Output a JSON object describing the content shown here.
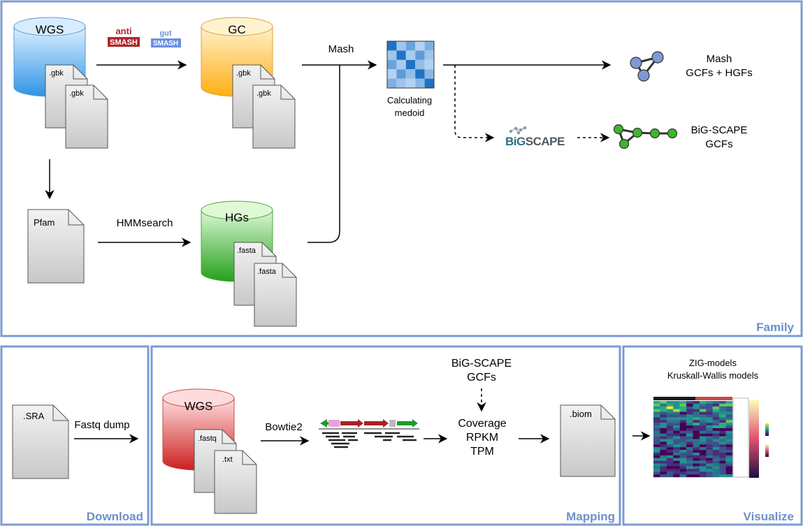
{
  "panels": {
    "family": "Family",
    "download": "Download",
    "mapping": "Mapping",
    "visualize": "Visualize"
  },
  "databases": {
    "wgs_top": "WGS",
    "gc": "GC",
    "hgs": "HGs",
    "wgs_mapping": "WGS"
  },
  "files": {
    "gbk": ".gbk",
    "fasta": ".fasta",
    "pfam": "Pfam",
    "sra": ".SRA",
    "fastq": ".fastq",
    "txt": ".txt",
    "biom": ".biom"
  },
  "logos": {
    "antismash_top": "anti",
    "antismash_bottom": "SMASH",
    "gutsmash_top": "gut",
    "gutsmash_bottom": "SMASH",
    "bigscape": "BiGSCAPE",
    "bigscape_big": "BiG",
    "bigscape_scape": "SCAPE"
  },
  "labels": {
    "mash": "Mash",
    "hmmsearch": "HMMsearch",
    "medoid_line1": "Calculating",
    "medoid_line2": "medoid",
    "mash_out_line1": "Mash",
    "mash_out_line2": "GCFs + HGFs",
    "bigscape_out_line1": "BiG-SCAPE",
    "bigscape_out_line2": "GCFs",
    "fastq_dump": "Fastq dump",
    "bowtie2": "Bowtie2",
    "bigscape_mapping_line1": "BiG-SCAPE",
    "bigscape_mapping_line2": "GCFs",
    "coverage": "Coverage",
    "rpkm": "RPKM",
    "tpm": "TPM",
    "zig": "ZIG-models",
    "kruskal": "Kruskall-Wallis models"
  },
  "colors": {
    "panel_border": "#7c9bd1",
    "panel_title": "#6e8fc9",
    "wgs_blue": "#3d9de8",
    "gc_orange": "#ffb822",
    "hgs_green": "#3aae2c",
    "wgs_red": "#d42f2f",
    "node_blue": "#7f98d6",
    "node_green": "#3fb52e",
    "antismash_red": "#b0282c",
    "gutsmash_blue": "#6b8fe0",
    "bigscape_teal": "#3a7f8c"
  },
  "medoid_matrix": [
    [
      0.9,
      0.3,
      0.55,
      0.2,
      0.45
    ],
    [
      0.3,
      0.9,
      0.25,
      0.6,
      0.3
    ],
    [
      0.55,
      0.25,
      0.9,
      0.35,
      0.2
    ],
    [
      0.2,
      0.6,
      0.35,
      0.9,
      0.4
    ],
    [
      0.45,
      0.3,
      0.2,
      0.4,
      0.9
    ]
  ]
}
